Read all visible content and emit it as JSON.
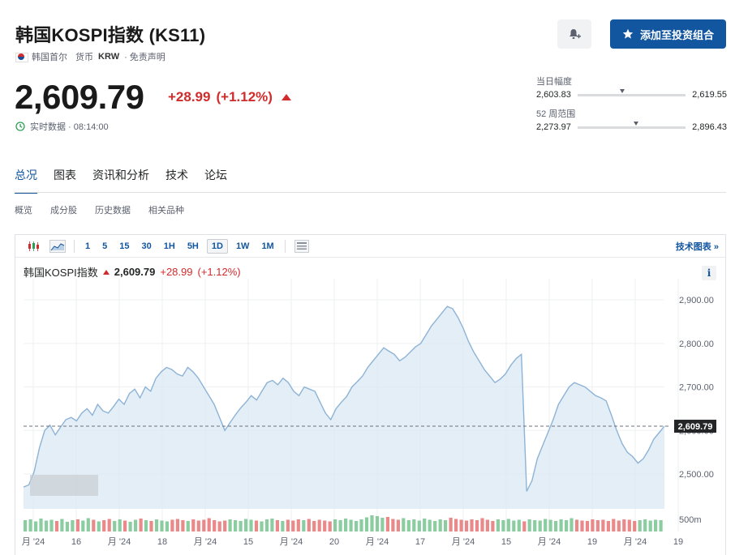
{
  "header": {
    "title": "韩国KOSPI指数 (KS11)",
    "location": "韩国首尔",
    "currency_label": "货币",
    "currency": "KRW",
    "disclaimer": "· 免责声明",
    "add_portfolio": "添加至投资组合"
  },
  "quote": {
    "price": "2,609.79",
    "change": "+28.99",
    "change_pct": "(+1.12%)",
    "realtime": "实时数据 · 08:14:00"
  },
  "ranges": {
    "day": {
      "label": "当日幅度",
      "low": "2,603.83",
      "high": "2,619.55",
      "position": 0.39
    },
    "week52": {
      "label": "52 周范围",
      "low": "2,273.97",
      "high": "2,896.43",
      "position": 0.52
    }
  },
  "tabs": [
    "总况",
    "图表",
    "资讯和分析",
    "技术",
    "论坛"
  ],
  "subtabs": [
    "概览",
    "成分股",
    "历史数据",
    "相关品种"
  ],
  "toolbar": {
    "intervals": [
      "1",
      "5",
      "15",
      "30",
      "1H",
      "5H",
      "1D",
      "1W",
      "1M"
    ],
    "active_interval": "1D",
    "tech_chart": "技术图表 »"
  },
  "legend": {
    "name": "韩国KOSPI指数",
    "value": "2,609.79",
    "change": "+28.99",
    "pct": "(+1.12%)"
  },
  "info_label": "i",
  "colors": {
    "accent": "#1256a0",
    "negative": "#d12c2c",
    "positive": "#2e9e57",
    "area": "#dbe8f3",
    "line": "#8db3d6"
  },
  "chart_data": {
    "type": "area",
    "y_ticks": [
      "2,900.00",
      "2,800.00",
      "2,700.00",
      "2,600.00",
      "2,500.00"
    ],
    "y_tick_values": [
      2900,
      2800,
      2700,
      2600,
      2500
    ],
    "ylim": [
      2420,
      2930
    ],
    "current_label": "2,609.79",
    "current_value": 2609.79,
    "volume_label": "500m",
    "x_tick_labels": [
      "月 '24",
      "16",
      "月 '24",
      "18",
      "月 '24",
      "15",
      "月 '24",
      "20",
      "月 '24",
      "17",
      "月 '24",
      "15",
      "月 '24",
      "19",
      "月 '24",
      "19"
    ],
    "values": [
      2470,
      2475,
      2505,
      2560,
      2600,
      2612,
      2590,
      2608,
      2625,
      2630,
      2622,
      2640,
      2650,
      2635,
      2660,
      2645,
      2640,
      2655,
      2672,
      2660,
      2685,
      2695,
      2675,
      2700,
      2690,
      2720,
      2735,
      2745,
      2740,
      2730,
      2725,
      2745,
      2735,
      2720,
      2700,
      2680,
      2660,
      2630,
      2600,
      2618,
      2636,
      2652,
      2665,
      2680,
      2670,
      2690,
      2710,
      2715,
      2705,
      2720,
      2710,
      2690,
      2680,
      2700,
      2695,
      2690,
      2665,
      2640,
      2625,
      2650,
      2665,
      2678,
      2700,
      2712,
      2725,
      2745,
      2760,
      2775,
      2790,
      2782,
      2775,
      2760,
      2768,
      2780,
      2792,
      2800,
      2820,
      2840,
      2855,
      2870,
      2885,
      2880,
      2860,
      2835,
      2805,
      2780,
      2760,
      2740,
      2725,
      2710,
      2718,
      2730,
      2750,
      2765,
      2775,
      2460,
      2485,
      2535,
      2565,
      2595,
      2625,
      2660,
      2680,
      2700,
      2710,
      2705,
      2700,
      2690,
      2680,
      2675,
      2668,
      2635,
      2600,
      2570,
      2550,
      2540,
      2525,
      2535,
      2555,
      2580,
      2595,
      2610
    ],
    "volume": [
      28,
      30,
      25,
      32,
      27,
      29,
      26,
      31,
      24,
      28,
      30,
      27,
      33,
      29,
      25,
      28,
      31,
      26,
      30,
      27,
      24,
      29,
      32,
      28,
      26,
      30,
      27,
      25,
      29,
      31,
      28,
      26,
      30,
      27,
      29,
      33,
      28,
      25,
      27,
      30,
      28,
      26,
      31,
      29,
      27,
      25,
      30,
      32,
      28,
      26,
      29,
      27,
      30,
      28,
      31,
      26,
      29,
      27,
      25,
      30,
      28,
      32,
      29,
      26,
      30,
      35,
      40,
      38,
      34,
      36,
      31,
      29,
      33,
      28,
      30,
      27,
      32,
      29,
      26,
      30,
      28,
      34,
      31,
      29,
      27,
      30,
      28,
      33,
      29,
      26,
      30,
      28,
      31,
      27,
      29,
      25,
      30,
      28,
      27,
      31,
      29,
      26,
      30,
      28,
      33,
      29,
      27,
      26,
      30,
      28,
      29,
      26,
      31,
      27,
      30,
      29,
      26,
      28,
      30,
      27,
      29,
      28
    ]
  }
}
